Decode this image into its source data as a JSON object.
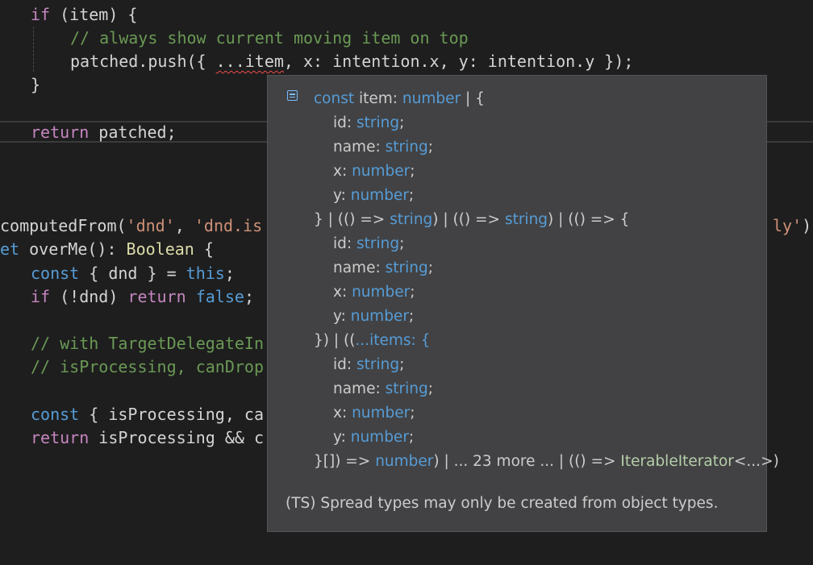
{
  "editor": {
    "lines": [
      {
        "id": "if-item",
        "tokens": [
          {
            "t": "if",
            "c": "kw2"
          },
          {
            "t": " (item) {",
            "c": "plain"
          }
        ]
      },
      {
        "id": "comment-always",
        "tokens": [
          {
            "t": "// always show current moving item on top",
            "c": "cmt"
          }
        ]
      },
      {
        "id": "patched-push",
        "tokens": [
          {
            "t": "patched.push({ ",
            "c": "plain"
          },
          {
            "t": "...item",
            "c": "plain",
            "squiggle": true
          },
          {
            "t": ", x: intention.x, y: intention.y });",
            "c": "plain"
          }
        ]
      },
      {
        "id": "close-brace",
        "tokens": [
          {
            "t": "}",
            "c": "plain"
          }
        ]
      },
      {
        "id": "return-patched",
        "tokens": [
          {
            "t": "return",
            "c": "kw2"
          },
          {
            "t": " patched;",
            "c": "plain"
          }
        ]
      },
      {
        "id": "computed-from",
        "tokens": [
          {
            "t": "computedFrom(",
            "c": "plain"
          },
          {
            "t": "'dnd'",
            "c": "str"
          },
          {
            "t": ", ",
            "c": "plain"
          },
          {
            "t": "'dnd.is",
            "c": "str"
          }
        ]
      },
      {
        "id": "computed-from-tail",
        "tokens": [
          {
            "t": "ly'",
            "c": "str"
          },
          {
            "t": ")",
            "c": "plain"
          }
        ]
      },
      {
        "id": "get-overme",
        "tokens": [
          {
            "t": "et",
            "c": "kw"
          },
          {
            "t": " overMe(): ",
            "c": "plain"
          },
          {
            "t": "Boolean",
            "c": "fn"
          },
          {
            "t": " {",
            "c": "plain"
          }
        ]
      },
      {
        "id": "const-dnd",
        "tokens": [
          {
            "t": "const",
            "c": "kw"
          },
          {
            "t": " { dnd } = ",
            "c": "plain"
          },
          {
            "t": "this",
            "c": "kw"
          },
          {
            "t": ";",
            "c": "plain"
          }
        ]
      },
      {
        "id": "if-not-dnd",
        "tokens": [
          {
            "t": "if",
            "c": "kw2"
          },
          {
            "t": " (!dnd) ",
            "c": "plain"
          },
          {
            "t": "return",
            "c": "kw2"
          },
          {
            "t": " ",
            "c": "plain"
          },
          {
            "t": "false",
            "c": "kw"
          },
          {
            "t": ";",
            "c": "plain"
          }
        ]
      },
      {
        "id": "comment-with",
        "tokens": [
          {
            "t": "// with TargetDelegateIn",
            "c": "cmt"
          }
        ]
      },
      {
        "id": "comment-isprocessing",
        "tokens": [
          {
            "t": "// isProcessing, canDrop",
            "c": "cmt"
          }
        ]
      },
      {
        "id": "const-isprocessing",
        "tokens": [
          {
            "t": "const",
            "c": "kw"
          },
          {
            "t": " { isProcessing, ca",
            "c": "plain"
          }
        ]
      },
      {
        "id": "return-isprocessing",
        "tokens": [
          {
            "t": "return",
            "c": "kw2"
          },
          {
            "t": " isProcessing && c",
            "c": "plain"
          }
        ]
      }
    ]
  },
  "hover": {
    "signature_lines": [
      {
        "id": "sig-0",
        "tokens": [
          {
            "t": "const",
            "c": "t-kw"
          },
          {
            "t": " item: ",
            "c": "t-plain"
          },
          {
            "t": "number",
            "c": "t-type"
          },
          {
            "t": " | {",
            "c": "t-plain"
          }
        ]
      },
      {
        "id": "sig-1",
        "tokens": [
          {
            "t": "id: ",
            "c": "t-plain"
          },
          {
            "t": "string",
            "c": "t-type"
          },
          {
            "t": ";",
            "c": "t-plain"
          }
        ]
      },
      {
        "id": "sig-2",
        "tokens": [
          {
            "t": "name: ",
            "c": "t-plain"
          },
          {
            "t": "string",
            "c": "t-type"
          },
          {
            "t": ";",
            "c": "t-plain"
          }
        ]
      },
      {
        "id": "sig-3",
        "tokens": [
          {
            "t": "x: ",
            "c": "t-plain"
          },
          {
            "t": "number",
            "c": "t-type"
          },
          {
            "t": ";",
            "c": "t-plain"
          }
        ]
      },
      {
        "id": "sig-4",
        "tokens": [
          {
            "t": "y: ",
            "c": "t-plain"
          },
          {
            "t": "number",
            "c": "t-type"
          },
          {
            "t": ";",
            "c": "t-plain"
          }
        ]
      },
      {
        "id": "sig-5",
        "tokens": [
          {
            "t": "} | (() => ",
            "c": "t-plain"
          },
          {
            "t": "string",
            "c": "t-type"
          },
          {
            "t": ") | (() => ",
            "c": "t-plain"
          },
          {
            "t": "string",
            "c": "t-type"
          },
          {
            "t": ") | (() => {",
            "c": "t-plain"
          }
        ]
      },
      {
        "id": "sig-6",
        "tokens": [
          {
            "t": "id: ",
            "c": "t-plain"
          },
          {
            "t": "string",
            "c": "t-type"
          },
          {
            "t": ";",
            "c": "t-plain"
          }
        ]
      },
      {
        "id": "sig-7",
        "tokens": [
          {
            "t": "name: ",
            "c": "t-plain"
          },
          {
            "t": "string",
            "c": "t-type"
          },
          {
            "t": ";",
            "c": "t-plain"
          }
        ]
      },
      {
        "id": "sig-8",
        "tokens": [
          {
            "t": "x: ",
            "c": "t-plain"
          },
          {
            "t": "number",
            "c": "t-type"
          },
          {
            "t": ";",
            "c": "t-plain"
          }
        ]
      },
      {
        "id": "sig-9",
        "tokens": [
          {
            "t": "y: ",
            "c": "t-plain"
          },
          {
            "t": "number",
            "c": "t-type"
          },
          {
            "t": ";",
            "c": "t-plain"
          }
        ]
      },
      {
        "id": "sig-10",
        "tokens": [
          {
            "t": "}) | ((",
            "c": "t-plain"
          },
          {
            "t": "...items: {",
            "c": "t-kw"
          }
        ]
      },
      {
        "id": "sig-11",
        "tokens": [
          {
            "t": "id: ",
            "c": "t-plain"
          },
          {
            "t": "string",
            "c": "t-type"
          },
          {
            "t": ";",
            "c": "t-plain"
          }
        ]
      },
      {
        "id": "sig-12",
        "tokens": [
          {
            "t": "name: ",
            "c": "t-plain"
          },
          {
            "t": "string",
            "c": "t-type"
          },
          {
            "t": ";",
            "c": "t-plain"
          }
        ]
      },
      {
        "id": "sig-13",
        "tokens": [
          {
            "t": "x: ",
            "c": "t-plain"
          },
          {
            "t": "number",
            "c": "t-type"
          },
          {
            "t": ";",
            "c": "t-plain"
          }
        ]
      },
      {
        "id": "sig-14",
        "tokens": [
          {
            "t": "y: ",
            "c": "t-plain"
          },
          {
            "t": "number",
            "c": "t-type"
          },
          {
            "t": ";",
            "c": "t-plain"
          }
        ]
      },
      {
        "id": "sig-15",
        "tokens": [
          {
            "t": "}[]) => ",
            "c": "t-plain"
          },
          {
            "t": "number",
            "c": "t-type"
          },
          {
            "t": ") | ... 23 more ... | (() => ",
            "c": "t-plain"
          },
          {
            "t": "IterableIterator",
            "c": "t-iface"
          },
          {
            "t": "<...>)",
            "c": "t-plain"
          }
        ]
      }
    ],
    "error_message": "(TS) Spread types may only be created from object types."
  }
}
